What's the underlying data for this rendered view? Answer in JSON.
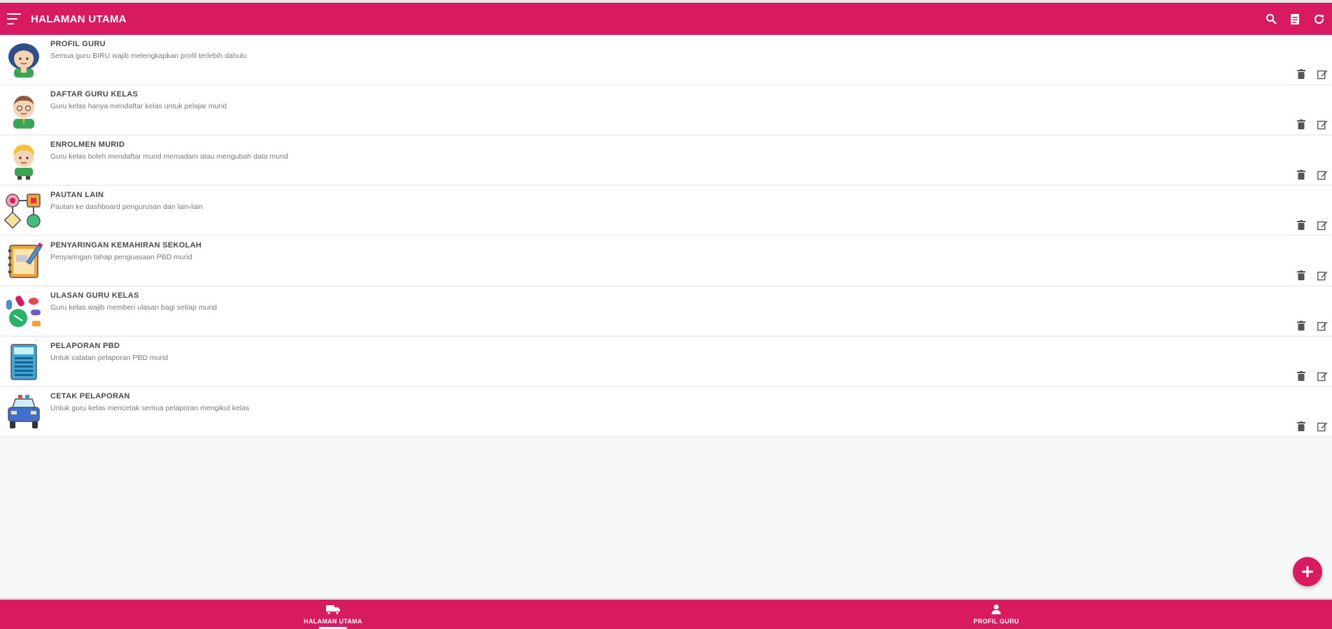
{
  "app": {
    "title": "HALAMAN UTAMA",
    "brand_color": "#d81b60"
  },
  "topbar_actions": [
    {
      "icon": "search-icon"
    },
    {
      "icon": "document-icon"
    },
    {
      "icon": "refresh-icon"
    }
  ],
  "items": [
    {
      "title": "PROFIL GURU",
      "desc": "Semua guru BIRU wajib melengkapkan profil terlebih dahulu",
      "icon": "teacher-female-icon"
    },
    {
      "title": "DAFTAR GURU KELAS",
      "desc": "Guru kelas hanya mendaftar kelas untuk pelajar murid",
      "icon": "teacher-male-icon"
    },
    {
      "title": "ENROLMEN MURID",
      "desc": "Guru kelas boleh mendaftar murid memadam atau mengubah data murid",
      "icon": "student-icon"
    },
    {
      "title": "PAUTAN LAIN",
      "desc": "Pautan ke dashboard pengurusan dan lain-lain",
      "icon": "links-icon"
    },
    {
      "title": "PENYARINGAN KEMAHIRAN SEKOLAH",
      "desc": "Penyaringan tahap penguasaan PBD murid",
      "icon": "notebook-icon"
    },
    {
      "title": "ULASAN GURU KELAS",
      "desc": "Guru kelas wajib memberi ulasan bagi setiap murid",
      "icon": "pills-icon"
    },
    {
      "title": "PELAPORAN PBD",
      "desc": "Untuk catatan pelaporan PBD murid",
      "icon": "calculator-icon"
    },
    {
      "title": "CETAK PELAPORAN",
      "desc": "Untuk guru kelas mencetak semua pelaporan mengikut kelas",
      "icon": "car-icon"
    }
  ],
  "bottom_nav": [
    {
      "label": "HALAMAN UTAMA",
      "icon": "truck-icon",
      "active": true
    },
    {
      "label": "PROFIL GURU",
      "icon": "person-icon",
      "active": false
    }
  ]
}
